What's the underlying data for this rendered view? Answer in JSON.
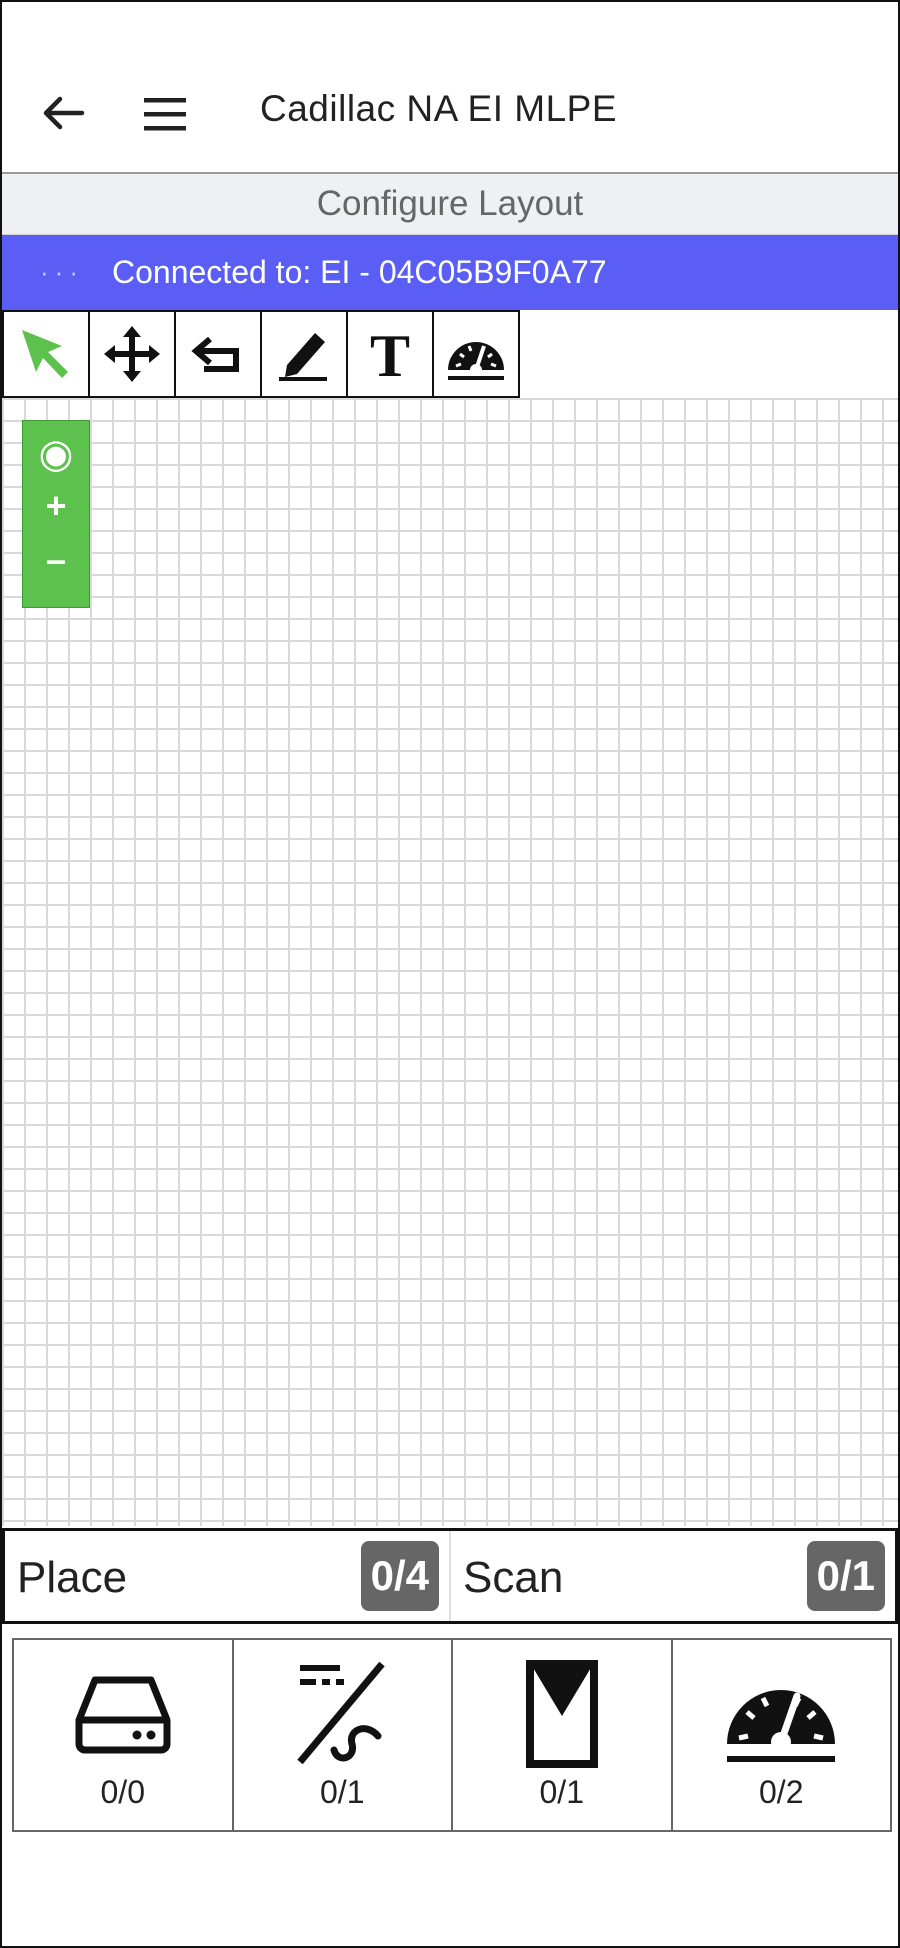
{
  "appbar": {
    "title": "Cadillac NA EI MLPE",
    "back_icon": "arrow-left-icon",
    "menu_icon": "hamburger-menu-icon"
  },
  "subheader": {
    "title": "Configure Layout"
  },
  "banner": {
    "dots": "···",
    "text": "Connected to: EI - 04C05B9F0A77",
    "color": "#5b5ef5"
  },
  "toolbar": {
    "tools": [
      "select-arrow-icon",
      "move-icon",
      "undo-icon",
      "pencil-icon",
      "text-tool-icon",
      "gauge-icon"
    ],
    "active_color": "#5cc14d"
  },
  "zoom": {
    "center": "◉",
    "plus": "+",
    "minus": "–"
  },
  "status": {
    "place_label": "Place",
    "place_count": "0/4",
    "scan_label": "Scan",
    "scan_count": "0/1"
  },
  "tiles": [
    {
      "icon": "gateway-device-icon",
      "count": "0/0"
    },
    {
      "icon": "string-wiring-icon",
      "count": "0/1"
    },
    {
      "icon": "panel-envelope-icon",
      "count": "0/1"
    },
    {
      "icon": "meter-gauge-icon",
      "count": "0/2"
    }
  ]
}
